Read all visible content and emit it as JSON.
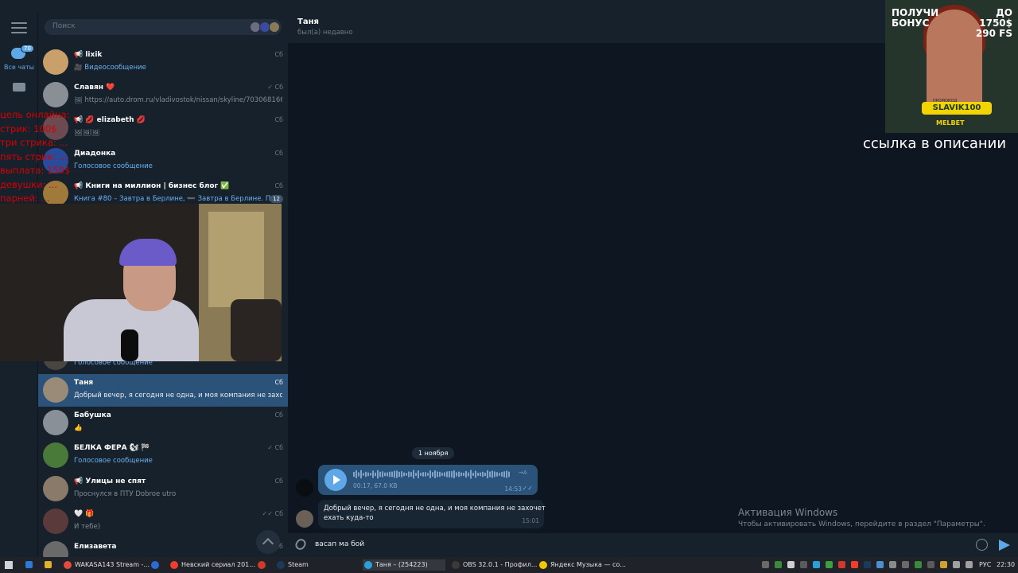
{
  "search": {
    "placeholder": "Поиск"
  },
  "sidebar": {
    "all_chats_label": "Все чаты",
    "unread_badge": "70"
  },
  "chats": [
    {
      "name": "📢 lixik",
      "time": "Сб",
      "preview": "🎥 Видеосообщение",
      "preview_blue": true,
      "avatar_color": "#c9a06a"
    },
    {
      "name": "Славян ❤️",
      "time": "✓ Сб",
      "preview": "🖼 https://auto.drom.ru/vladivostok/nissan/skyline/703068166...",
      "preview_blue": false,
      "avatar_color": "#8a8f96"
    },
    {
      "name": "📢 💋 elizabeth 💋",
      "time": "Сб",
      "preview": "🖼🖼🖼",
      "preview_blue": false,
      "avatar_color": "#6b4a52"
    },
    {
      "name": "Диадонка",
      "time": "Сб",
      "preview": "Голосовое сообщение",
      "preview_blue": true,
      "avatar_color": "#2a4a9a"
    },
    {
      "name": "📢 Книги на миллион | бизнес блог ✅",
      "time": "Сб",
      "preview": "Книга #80 – Завтра в Берлине, ➖ Завтра в Берлине. По...",
      "preview_blue": true,
      "count": "12",
      "avatar_color": "#a07a3a"
    },
    {
      "name": "",
      "time": "",
      "preview": "",
      "preview_blue": false,
      "avatar_color": "#3a3f45"
    },
    {
      "name": "",
      "time": "",
      "preview": "",
      "preview_blue": false,
      "avatar_color": "#3a3f45"
    },
    {
      "name": "",
      "time": "",
      "preview": "",
      "preview_blue": false,
      "avatar_color": "#3a3f45"
    },
    {
      "name": "",
      "time": "",
      "preview": "",
      "preview_blue": false,
      "avatar_color": "#3a3f45"
    },
    {
      "name": "",
      "time": "",
      "preview": "Голосовое сообщение",
      "preview_blue": true,
      "avatar_color": "#4a4540"
    },
    {
      "name": "Таня",
      "time": "Сб",
      "preview": "Добрый вечер, я сегодня не одна, и моя компания не захочет...",
      "preview_blue": false,
      "active": true,
      "avatar_color": "#9a8a78"
    },
    {
      "name": "Бабушка",
      "time": "Сб",
      "preview": "👍",
      "preview_blue": false,
      "avatar_color": "#8a9098"
    },
    {
      "name": "БЕЛКА ФЕРА 🐿 🏁",
      "time": "✓ Сб",
      "preview": "Голосовое сообщение",
      "preview_blue": true,
      "avatar_color": "#4a7a3a"
    },
    {
      "name": "📢 Улицы не спят",
      "time": "Сб",
      "preview": "Проснулся в ПТУ Dobroe utro",
      "preview_blue": false,
      "avatar_color": "#8a7a6a"
    },
    {
      "name": "🤍 🎁",
      "time": "✓✓ Сб",
      "preview": "И тебе)",
      "preview_blue": false,
      "avatar_color": "#5a3a3a"
    },
    {
      "name": "Елизавета",
      "time": "Сб",
      "preview": "",
      "preview_blue": false,
      "avatar_color": "#6a6a6a"
    }
  ],
  "chat": {
    "name": "Таня",
    "status": "был(а) недавно"
  },
  "date_divider": "1 ноября",
  "voice_msg": {
    "meta": "00:17, 67.0 KB",
    "time": "14:53",
    "check": "✓✓",
    "transcribe": "→A"
  },
  "text_msg": {
    "line1": "Добрый вечер, я сегодня не одна, и моя компания не захочет",
    "line2": "ехать куда-то",
    "time": "15:01"
  },
  "composer": {
    "value": "васап ма бой"
  },
  "windows_activation": {
    "title": "Активация Windows",
    "subtitle": "Чтобы активировать Windows, перейдите в раздел \"Параметры\"."
  },
  "overlay": {
    "lines": [
      "цель онлайна: ...",
      "стрик: 100$",
      "три стрика: ...",
      "пять стрик: ...",
      "выплата: 150$",
      "девушки: ...",
      "парней: ..."
    ]
  },
  "ad": {
    "headline_left": "ПОЛУЧИ БОНУС",
    "headline_right": "ДО 1750$ 290 FS",
    "promo_label": "ПРОМОКОД",
    "promo_code": "SLAVIK100",
    "brand": "MELBET",
    "caption": "ссылка в описании"
  },
  "taskbar": {
    "items": [
      {
        "label": "WAKASA143 Stream -...",
        "color": "#e24c3a",
        "active": false
      },
      {
        "label": "",
        "color": "#2a6bd6",
        "active": false
      },
      {
        "label": "Невский сериал 201...",
        "color": "#f23c2c",
        "active": false
      },
      {
        "label": "",
        "color": "#d03a2c",
        "active": false
      },
      {
        "label": "Steam",
        "color": "#1b3a5a",
        "active": false
      },
      {
        "label": "Таня – (254223)",
        "color": "#2aa0da",
        "active": true
      },
      {
        "label": "OBS 32.0.1 - Профил...",
        "color": "#3a3a3a",
        "active": false
      },
      {
        "label": "Яндекс Музыка — со...",
        "color": "#f2c600",
        "active": false
      }
    ],
    "lang": "РУС",
    "clock": "22:30"
  }
}
